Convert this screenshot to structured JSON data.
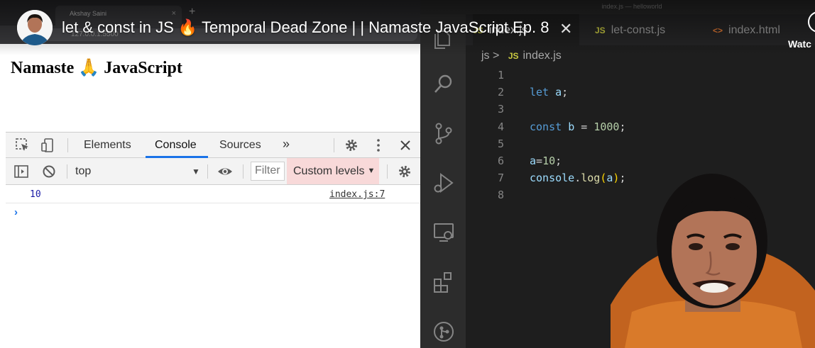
{
  "video": {
    "title": "let & const in JS 🔥 Temporal Dead Zone | | Namaste JavaScript Ep. 8",
    "close_glyph": "✕",
    "watch_later": "Watc"
  },
  "browser": {
    "tab_title": "Akshay Saini",
    "tab_close": "×",
    "new_tab": "+",
    "url": "127.0.0.1:5500",
    "page_heading": "Namaste 🙏 JavaScript"
  },
  "devtools": {
    "tabs": [
      "Elements",
      "Console",
      "Sources"
    ],
    "more": "»",
    "active_tab": "Console",
    "context": "top",
    "filter_placeholder": "Filter",
    "levels": "Custom levels",
    "log_value": "10",
    "log_source": "index.js:7",
    "prompt": "›",
    "colors": {
      "accent": "#1a73e8",
      "levels_bg": "#f8d9d9"
    }
  },
  "vscode": {
    "window_title": "index.js — helloworld",
    "tabs": [
      {
        "icon": "JS",
        "label": "index.js"
      },
      {
        "icon": "JS",
        "label": "let-const.js"
      },
      {
        "icon": "<>",
        "label": "index.html"
      }
    ],
    "breadcrumb": {
      "folder": "js",
      "sep": ">",
      "icon": "JS",
      "file": "index.js"
    },
    "line_numbers": [
      "1",
      "2",
      "3",
      "4",
      "5",
      "6",
      "7",
      "8"
    ],
    "code": {
      "l2_kw": "let",
      "l2_var": "a",
      "l2_end": ";",
      "l4_kw": "const",
      "l4_var": "b",
      "l4_op": " = ",
      "l4_num": "1000",
      "l4_end": ";",
      "l6_var": "a",
      "l6_op": "=",
      "l6_num": "10",
      "l6_end": ";",
      "l7_obj": "console",
      "l7_dot": ".",
      "l7_fn": "log",
      "l7_open": "(",
      "l7_arg": "a",
      "l7_close": ")",
      "l7_end": ";"
    },
    "activity_icons": [
      "files-icon",
      "search-icon",
      "source-control-icon",
      "run-debug-icon",
      "remote-explorer-icon",
      "extensions-icon",
      "git-graph-icon"
    ]
  }
}
